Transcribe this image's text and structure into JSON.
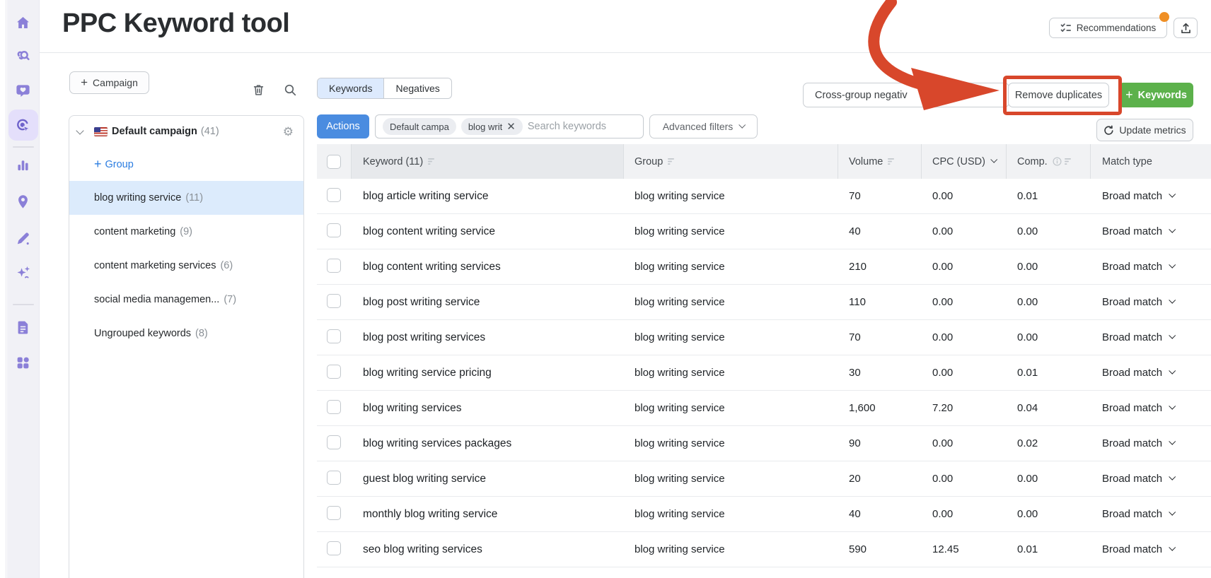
{
  "colors": {
    "accent_blue": "#4a8ce0",
    "accent_green": "#5cb14b",
    "annotation_red": "#d8472b",
    "badge_orange": "#ef8f25",
    "sidebar_purple": "#8b80d8",
    "selected_group_bg": "#dcebfc",
    "selected_tab_bg": "#ddeafd",
    "link_blue": "#2b7de1"
  },
  "sidebar": {
    "icons": [
      {
        "name": "home-icon"
      },
      {
        "name": "research-icon"
      },
      {
        "name": "social-feedback-icon"
      },
      {
        "name": "ppc-tool-icon",
        "active": true
      },
      {
        "name": "bar-chart-icon"
      },
      {
        "name": "location-pin-icon"
      },
      {
        "name": "edit-pencil-icon"
      },
      {
        "name": "ai-sparkles-icon"
      },
      {
        "name": "report-document-icon"
      },
      {
        "name": "apps-grid-icon"
      }
    ]
  },
  "header": {
    "title": "PPC Keyword tool",
    "recommendations_label": "Recommendations"
  },
  "left_panel": {
    "campaign_button_label": "Campaign",
    "campaign": {
      "name": "Default campaign",
      "count": "(41)"
    },
    "add_group_label": "Group",
    "groups": [
      {
        "name": "blog writing service",
        "count": "(11)",
        "selected": true
      },
      {
        "name": "content marketing",
        "count": "(9)"
      },
      {
        "name": "content marketing services",
        "count": "(6)"
      },
      {
        "name": "social media managemen...",
        "count": "(7)"
      },
      {
        "name": "Ungrouped keywords",
        "count": "(8)"
      }
    ]
  },
  "toolbar": {
    "tabs": {
      "keywords": "Keywords",
      "negatives": "Negatives"
    },
    "cross_group_label": "Cross-group negativ",
    "remove_duplicates_label": "Remove duplicates",
    "add_keywords_label": "Keywords",
    "update_metrics_label": "Update metrics",
    "actions_label": "Actions",
    "filter_chips": {
      "chip1": "Default campa",
      "chip2": "blog writ"
    },
    "search_placeholder": "Search keywords",
    "advanced_filters_label": "Advanced filters"
  },
  "table": {
    "headers": {
      "keyword": "Keyword (11)",
      "group": "Group",
      "volume": "Volume",
      "cpc": "CPC (USD)",
      "comp": "Comp.",
      "match": "Match type"
    },
    "rows": [
      {
        "keyword": "blog article writing service",
        "group": "blog writing service",
        "volume": "70",
        "cpc": "0.00",
        "comp": "0.01",
        "match": "Broad match"
      },
      {
        "keyword": "blog content writing service",
        "group": "blog writing service",
        "volume": "40",
        "cpc": "0.00",
        "comp": "0.00",
        "match": "Broad match"
      },
      {
        "keyword": "blog content writing services",
        "group": "blog writing service",
        "volume": "210",
        "cpc": "0.00",
        "comp": "0.00",
        "match": "Broad match"
      },
      {
        "keyword": "blog post writing service",
        "group": "blog writing service",
        "volume": "110",
        "cpc": "0.00",
        "comp": "0.00",
        "match": "Broad match"
      },
      {
        "keyword": "blog post writing services",
        "group": "blog writing service",
        "volume": "70",
        "cpc": "0.00",
        "comp": "0.00",
        "match": "Broad match"
      },
      {
        "keyword": "blog writing service pricing",
        "group": "blog writing service",
        "volume": "30",
        "cpc": "0.00",
        "comp": "0.01",
        "match": "Broad match"
      },
      {
        "keyword": "blog writing services",
        "group": "blog writing service",
        "volume": "1,600",
        "cpc": "7.20",
        "comp": "0.04",
        "match": "Broad match"
      },
      {
        "keyword": "blog writing services packages",
        "group": "blog writing service",
        "volume": "90",
        "cpc": "0.00",
        "comp": "0.02",
        "match": "Broad match"
      },
      {
        "keyword": "guest blog writing service",
        "group": "blog writing service",
        "volume": "20",
        "cpc": "0.00",
        "comp": "0.00",
        "match": "Broad match"
      },
      {
        "keyword": "monthly blog writing service",
        "group": "blog writing service",
        "volume": "40",
        "cpc": "0.00",
        "comp": "0.00",
        "match": "Broad match"
      },
      {
        "keyword": "seo blog writing services",
        "group": "blog writing service",
        "volume": "590",
        "cpc": "12.45",
        "comp": "0.01",
        "match": "Broad match"
      }
    ]
  }
}
